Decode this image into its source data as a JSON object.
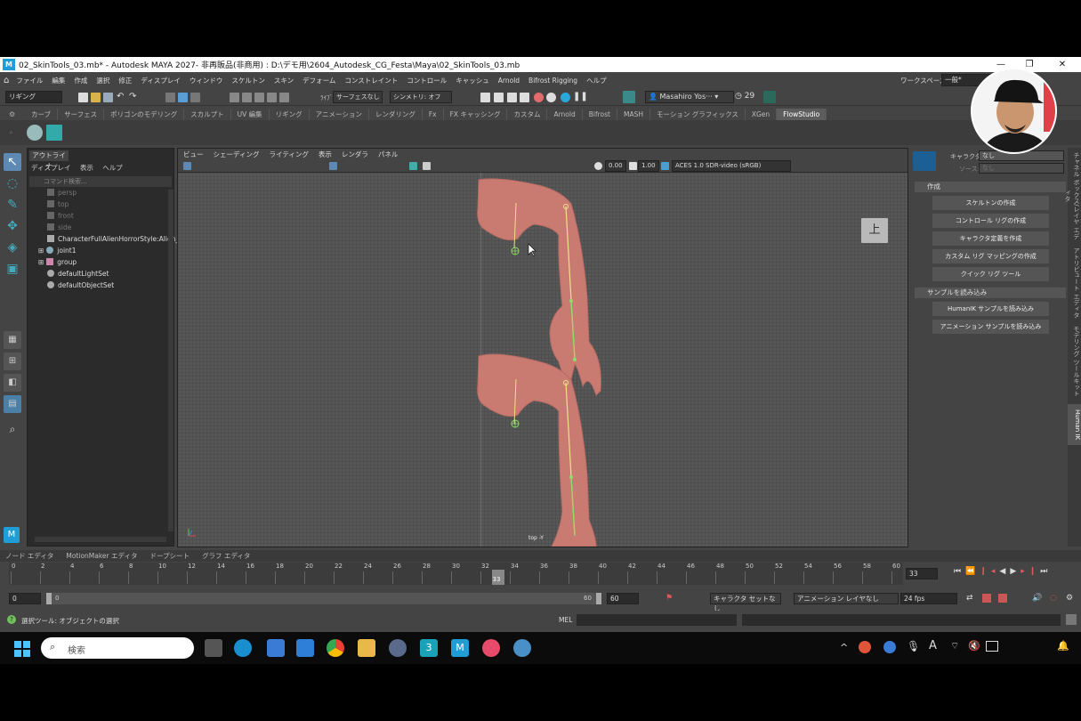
{
  "window": {
    "title": "02_SkinTools_03.mb* - Autodesk MAYA 2027- 非再販品(非商用) : D:\\デモ用\\2604_Autodesk_CG_Festa\\Maya\\02_SkinTools_03.mb",
    "logo": "M"
  },
  "menubar": [
    "ファイル",
    "編集",
    "作成",
    "選択",
    "修正",
    "ディスプレイ",
    "ウィンドウ",
    "スケルトン",
    "スキン",
    "デフォーム",
    "コンストレイント",
    "コントロール",
    "キャッシュ",
    "Arnold",
    "Bifrost Rigging",
    "ヘルプ"
  ],
  "workspace": {
    "label": "ワークスペース:",
    "value": "一般*"
  },
  "statusline": {
    "mode": "リギング",
    "live_label": "ﾗｲﾌﾞ",
    "live_value": "サーフェスなし",
    "symmetry": "シンメトリ: オフ",
    "user": "Masahiro Yos···",
    "notifications": "29"
  },
  "shelf_tabs": [
    "カーブ",
    "サーフェス",
    "ポリゴンのモデリング",
    "スカルプト",
    "UV 編集",
    "リギング",
    "アニメーション",
    "レンダリング",
    "Fx",
    "FX キャッシング",
    "カスタム",
    "Arnold",
    "Bifrost",
    "MASH",
    "モーション グラフィックス",
    "XGen",
    "FlowStudio"
  ],
  "shelf_active": "FlowStudio",
  "outliner": {
    "tab": "アウトライナ",
    "menu": [
      "ディスプレイ",
      "表示",
      "ヘルプ"
    ],
    "search_placeholder": "コマンド検索...",
    "items": [
      {
        "name": "persp",
        "dim": true
      },
      {
        "name": "top",
        "dim": true
      },
      {
        "name": "front",
        "dim": true
      },
      {
        "name": "side",
        "dim": true
      },
      {
        "name": "CharacterFullAlienHorrorStyle:Alien_",
        "dim": false
      },
      {
        "name": "joint1",
        "dim": false
      },
      {
        "name": "group",
        "dim": false
      },
      {
        "name": "defaultLightSet",
        "dim": false
      },
      {
        "name": "defaultObjectSet",
        "dim": false
      }
    ]
  },
  "viewport": {
    "menu": [
      "ビュー",
      "シェーディング",
      "ライティング",
      "表示",
      "レンダラ",
      "パネル"
    ],
    "exposure": "0.00",
    "gamma": "1.00",
    "color_space": "ACES 1.0 SDR-video (sRGB)",
    "view_cube": "上",
    "camera_label": "top -Y"
  },
  "humanik": {
    "character_label": "キャラクタ:",
    "character_value": "なし",
    "source_label": "ソース:",
    "source_value": "なし",
    "section_create": "作成",
    "buttons_create": [
      "スケルトンの作成",
      "コントロール リグの作成",
      "キャラクタ定義を作成",
      "カスタム リグ マッピングの作成",
      "クイック リグ ツール"
    ],
    "section_sample": "サンプルを読み込み",
    "buttons_sample": [
      "HumanIK サンプルを読み込み",
      "アニメーション サンプルを読み込み"
    ]
  },
  "side_tabs": [
    "チャネル ボックス/レイヤ エディタ",
    "アトリビュート エディタ",
    "モデリング ツールキット",
    "Human IK"
  ],
  "time_tabs": [
    "ノード エディタ",
    "MotionMaker エディタ",
    "ドープシート",
    "グラフ エディタ"
  ],
  "timeline": {
    "ticks": [
      "0",
      "2",
      "4",
      "6",
      "8",
      "10",
      "12",
      "14",
      "16",
      "18",
      "20",
      "22",
      "24",
      "26",
      "28",
      "30",
      "32",
      "34",
      "36",
      "38",
      "40",
      "42",
      "44",
      "46",
      "48",
      "50",
      "52",
      "54",
      "56",
      "58",
      "60"
    ],
    "current_frame": "33",
    "current_field": "33"
  },
  "range": {
    "start": "0",
    "inner_start": "0",
    "inner_end": "60",
    "end": "60",
    "character_set": "キャラクタ セットなし",
    "anim_layer": "アニメーション レイヤなし",
    "fps": "24 fps"
  },
  "helpline": "選択ツール: オブジェクトの選択",
  "cmd_label": "MEL",
  "taskbar": {
    "search_placeholder": "検索"
  }
}
